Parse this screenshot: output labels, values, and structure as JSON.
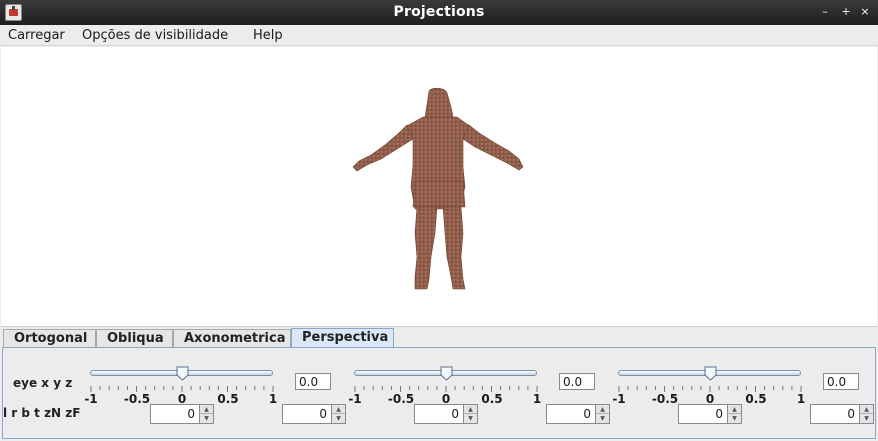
{
  "window": {
    "title": "Projections",
    "minimize_label": "–",
    "maximize_label": "+",
    "close_label": "×"
  },
  "menubar": {
    "items": [
      {
        "label": "Carregar"
      },
      {
        "label": "Opções de visibilidade"
      },
      {
        "label": "Help"
      }
    ]
  },
  "tabs": [
    {
      "label": "Ortogonal",
      "active": false
    },
    {
      "label": "Obliqua",
      "active": false
    },
    {
      "label": "Axonometrica",
      "active": false
    },
    {
      "label": "Perspectiva",
      "active": true
    }
  ],
  "perspective": {
    "eye_label": "eye x y z",
    "frustum_label": "l r b t zN zF",
    "slider_tick_labels": [
      "-1",
      "-0.5",
      "0",
      "0.5",
      "1"
    ],
    "eye_sliders": [
      {
        "name": "x",
        "min": -1,
        "max": 1,
        "value": 0.0,
        "display": "0.0"
      },
      {
        "name": "y",
        "min": -1,
        "max": 1,
        "value": 0.0,
        "display": "0.0"
      },
      {
        "name": "z",
        "min": -1,
        "max": 1,
        "value": 0.0,
        "display": "0.0"
      }
    ],
    "frustum_spinners": [
      {
        "name": "l",
        "value": "0"
      },
      {
        "name": "r",
        "value": "0"
      },
      {
        "name": "b",
        "value": "0"
      },
      {
        "name": "t",
        "value": "0"
      },
      {
        "name": "zN",
        "value": "0"
      },
      {
        "name": "zF",
        "value": "0"
      }
    ]
  },
  "colors": {
    "model": "#8b5a48",
    "active_tab": "#dbe6f6",
    "slider_track": "#c9d5e6"
  }
}
